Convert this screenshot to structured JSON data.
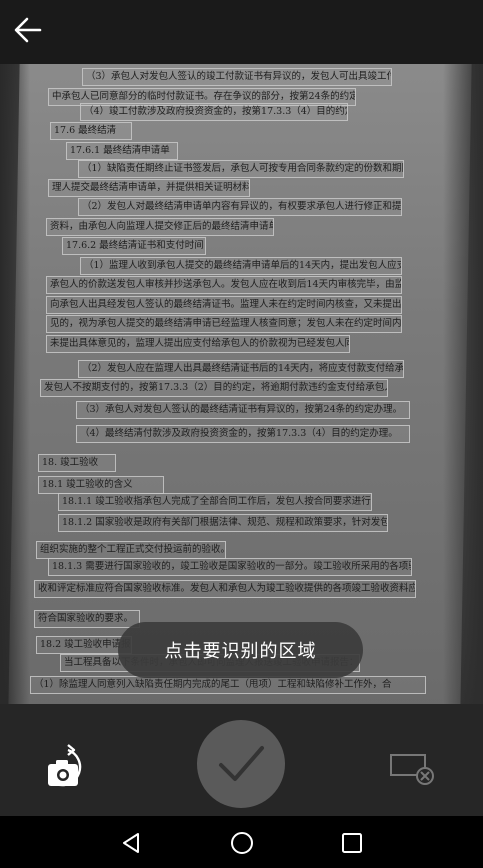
{
  "toast": {
    "message": "点击要识别的区域"
  },
  "icons": {
    "back": "arrow-left-icon",
    "retake": "camera-rotate-icon",
    "confirm": "checkmark-icon",
    "deselect": "rectangle-x-icon",
    "nav_back": "triangle-back-icon",
    "nav_home": "circle-home-icon",
    "nav_recent": "square-recents-icon"
  },
  "document": {
    "lines": [
      "（3）承包人对发包人签认的竣工付款证书有异议的，发包人可出具竣工付款申请单",
      "中承包人已同意部分的临时付款证书。存在争议的部分，按第24条的约定办理。",
      "（4）竣工付款涉及政府投资资金的，按第17.3.3（4）目的约定办理。",
      "17.6 最终结清",
      "17.6.1 最终结清申请单",
      "（1）缺陷责任期终止证书签发后，承包人可按专用合同条款约定的份数和期限向监",
      "理人提交最终结清申请单，并提供相关证明材料。",
      "（2）发包人对最终结清申请单内容有异议的，有权要求承包人进行修正和提供补充",
      "资料，由承包人向监理人提交修正后的最终结清申请单。",
      "17.6.2 最终结清证书和支付时间",
      "（1）监理人收到承包人提交的最终结清申请单后的14天内，提出发包人应支付给",
      "承包人的价款送发包人审核并抄送承包人。发包人应在收到后14天内审核完毕，由监理人",
      "向承包人出具经发包人签认的最终结清证书。监理人未在约定时间内核查，又未提出具体意",
      "见的，视为承包人提交的最终结清申请已经监理人核查同意；发包人未在约定时间内审核又",
      "未提出具体意见的，监理人提出应支付给承包人的价款视为已经发包人同意。",
      "（2）发包人应在监理人出具最终结清证书后的14天内，将应支付款支付给承包人。",
      "发包人不按期支付的，按第17.3.3（2）目的约定，将逾期付款违约金支付给承包人。",
      "（3）承包人对发包人签认的最终结清证书有异议的，按第24条的约定办理。",
      "（4）最终结清付款涉及政府投资资金的，按第17.3.3（4）目的约定办理。",
      "18. 竣工验收",
      "18.1 竣工验收的含义",
      "18.1.1 竣工验收指承包人完成了全部合同工作后，发包人按合同要求进行的验收。",
      "18.1.2 国家验收是政府有关部门根据法律、规范、规程和政策要求，针对发包人全面",
      "组织实施的整个工程正式交付投运前的验收。",
      "18.1.3 需要进行国家验收的，竣工验收是国家验收的一部分。竣工验收所采用的各项验",
      "收和评定标准应符合国家验收标准。发包人和承包人为竣工验收提供的各项竣工验收资料应",
      "符合国家验收的要求。",
      "18.2 竣工验收申请报告",
      "当工程具备以下条件时，承包人即可向监理人报送竣工验收申请报告：",
      "（1）除监理人同意列入缺陷责任期内完成的尾工（甩项）工程和缺陷修补工作外，合"
    ]
  }
}
